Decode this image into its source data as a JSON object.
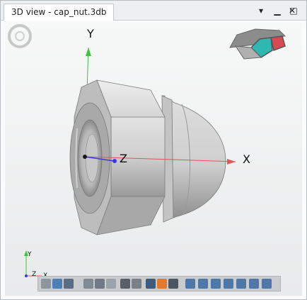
{
  "window": {
    "tab_title": "3D view - cap_nut.3db",
    "chevron_glyph": "▾",
    "minimize_glyph": "▁",
    "maximize_glyph": "□",
    "close_glyph": "✕"
  },
  "scene": {
    "axis_x_label": "X",
    "axis_y_label": "Y",
    "axis_z_label": "Z",
    "axis_x_color": "#e05555",
    "axis_y_color": "#3ec43e",
    "axis_z_color": "#3a3ad8",
    "mini_axes": {
      "y_label": "Y",
      "z_label": "Z",
      "x_label": "X"
    }
  },
  "toolbar": {
    "buttons": [
      {
        "name": "view-cylinder-icon"
      },
      {
        "name": "view-shaded-icon"
      },
      {
        "name": "view-solid-icon"
      },
      {
        "name": "zoom-icon"
      },
      {
        "name": "rotate-icon"
      },
      {
        "name": "light-icon"
      },
      {
        "name": "grid-icon"
      },
      {
        "name": "layers-icon"
      },
      {
        "name": "monitor-icon"
      },
      {
        "name": "render-icon"
      },
      {
        "name": "screen-icon"
      },
      {
        "name": "cube-view-1-icon"
      },
      {
        "name": "cube-view-2-icon"
      },
      {
        "name": "cube-view-3-icon"
      },
      {
        "name": "cube-view-4-icon"
      },
      {
        "name": "cube-view-5-icon"
      },
      {
        "name": "cube-view-6-icon"
      },
      {
        "name": "cube-view-7-icon"
      }
    ]
  }
}
